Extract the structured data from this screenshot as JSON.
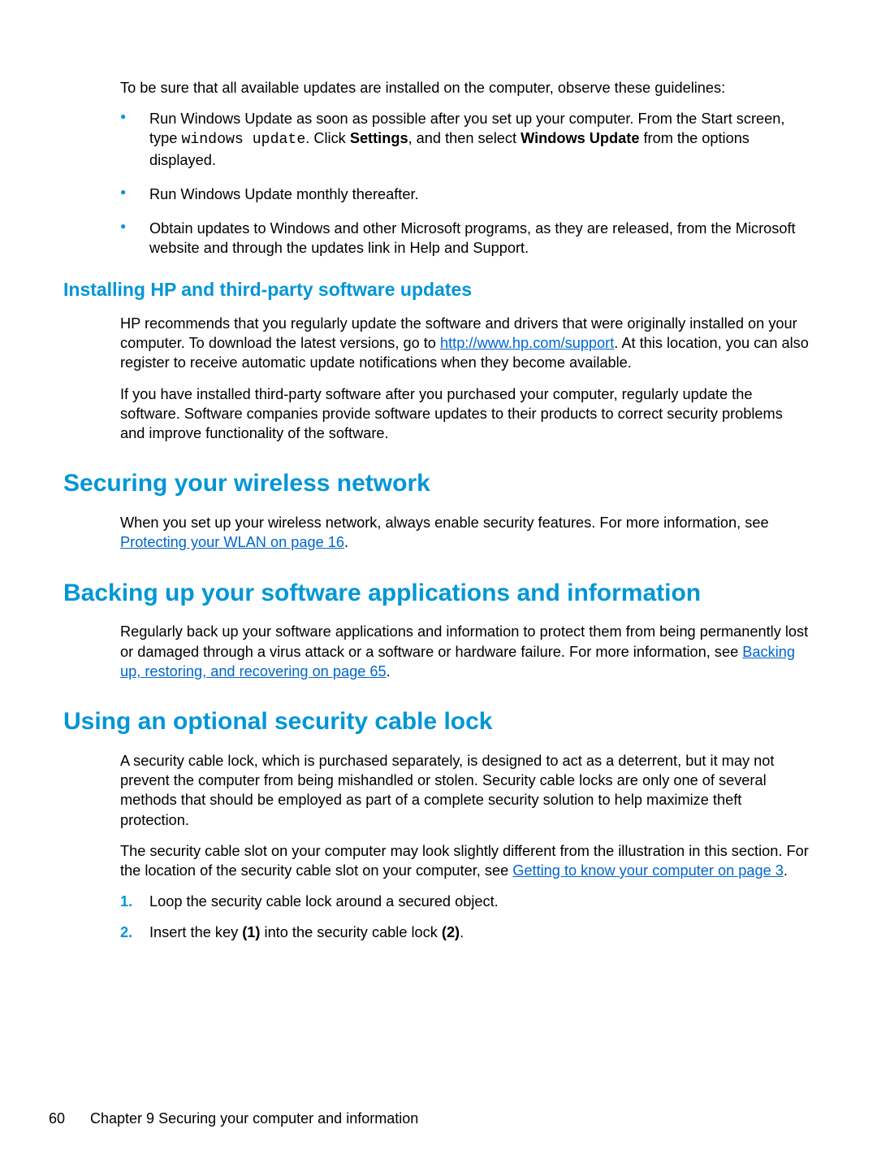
{
  "intro_para": "To be sure that all available updates are installed on the computer, observe these guidelines:",
  "bullets": {
    "b1_pre": "Run Windows Update as soon as possible after you set up your computer. From the Start screen, type ",
    "b1_mono": "windows update",
    "b1_mid1": ". Click ",
    "b1_bold1": "Settings",
    "b1_mid2": ", and then select ",
    "b1_bold2": "Windows Update",
    "b1_post": " from the options displayed.",
    "b2": "Run Windows Update monthly thereafter.",
    "b3": "Obtain updates to Windows and other Microsoft programs, as they are released, from the Microsoft website and through the updates link in Help and Support."
  },
  "h_install": "Installing HP and third-party software updates",
  "install_p1_pre": "HP recommends that you regularly update the software and drivers that were originally installed on your computer. To download the latest versions, go to ",
  "install_p1_link": "http://www.hp.com/support",
  "install_p1_post": ". At this location, you can also register to receive automatic update notifications when they become available.",
  "install_p2": "If you have installed third-party software after you purchased your computer, regularly update the software. Software companies provide software updates to their products to correct security problems and improve functionality of the software.",
  "h_secure": "Securing your wireless network",
  "secure_p_pre": "When you set up your wireless network, always enable security features. For more information, see ",
  "secure_p_link": "Protecting your WLAN on page 16",
  "secure_p_post": ".",
  "h_backup": "Backing up your software applications and information",
  "backup_p_pre": "Regularly back up your software applications and information to protect them from being permanently lost or damaged through a virus attack or a software or hardware failure. For more information, see ",
  "backup_p_link": "Backing up, restoring, and recovering on page 65",
  "backup_p_post": ".",
  "h_lock": "Using an optional security cable lock",
  "lock_p1": "A security cable lock, which is purchased separately, is designed to act as a deterrent, but it may not prevent the computer from being mishandled or stolen. Security cable locks are only one of several methods that should be employed as part of a complete security solution to help maximize theft protection.",
  "lock_p2_pre": "The security cable slot on your computer may look slightly different from the illustration in this section. For the location of the security cable slot on your computer, see ",
  "lock_p2_link": "Getting to know your computer on page 3",
  "lock_p2_post": ".",
  "steps": {
    "n1": "1.",
    "s1": "Loop the security cable lock around a secured object.",
    "n2": "2.",
    "s2_pre": "Insert the key ",
    "s2_b1": "(1)",
    "s2_mid": " into the security cable lock ",
    "s2_b2": "(2)",
    "s2_post": "."
  },
  "footer": {
    "page": "60",
    "chapter": "Chapter 9   Securing your computer and information"
  }
}
